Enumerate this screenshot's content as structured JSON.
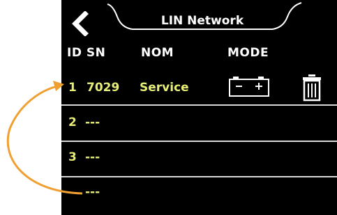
{
  "header": {
    "title": "LIN Network"
  },
  "columns": {
    "id_sn": "ID SN",
    "nom": "NOM",
    "mode": "MODE"
  },
  "rows": [
    {
      "id": "1",
      "sn": "7029",
      "nom": "Service"
    },
    {
      "id": "2",
      "sn": "---",
      "nom": ""
    },
    {
      "id": "3",
      "sn": "---",
      "nom": ""
    },
    {
      "id": "",
      "sn": "---",
      "nom": ""
    }
  ],
  "icons": {
    "back": "chevron-left-icon",
    "mode": "battery-icon",
    "delete": "trash-icon"
  },
  "colors": {
    "screen_bg": "#000000",
    "text_primary": "#ffffff",
    "text_value": "#e6ee75",
    "divider": "#d9d9d9",
    "annotation_arrow": "#f0a030"
  }
}
